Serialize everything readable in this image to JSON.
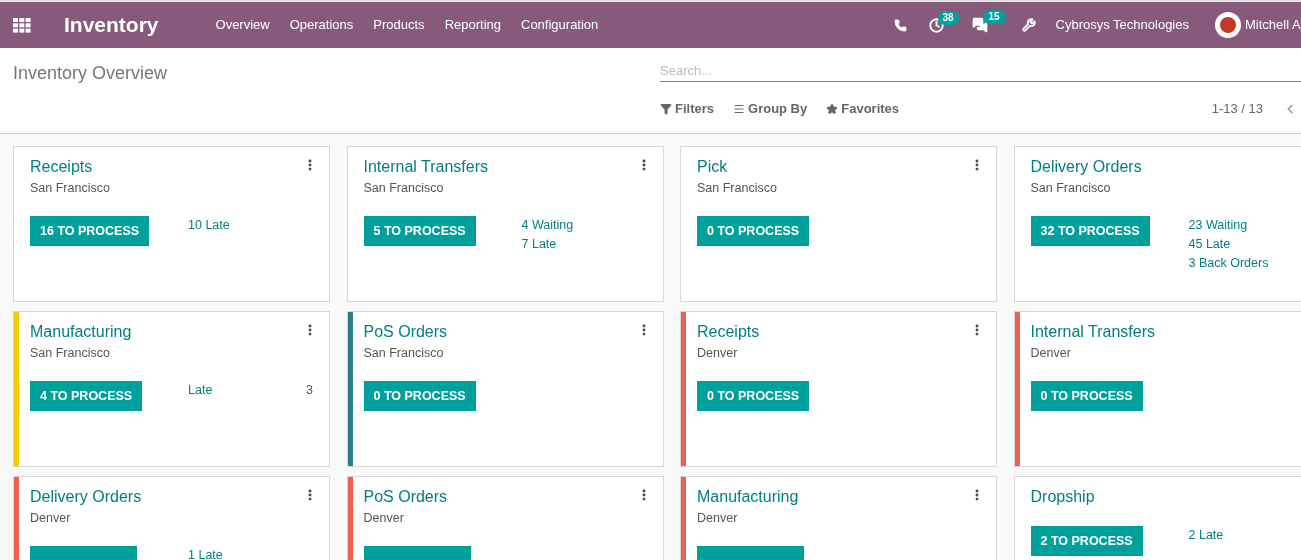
{
  "navbar": {
    "app_title": "Inventory",
    "menu": [
      "Overview",
      "Operations",
      "Products",
      "Reporting",
      "Configuration"
    ],
    "activity_count": "38",
    "message_count": "15",
    "company": "Cybrosys Technologies",
    "user": "Mitchell A"
  },
  "control_panel": {
    "title": "Inventory Overview",
    "search": {
      "placeholder": "Search..."
    },
    "search_options": [
      {
        "kind": "filter",
        "label": "Filters"
      },
      {
        "kind": "group",
        "label": "Group By"
      },
      {
        "kind": "favorite",
        "label": "Favorites"
      }
    ],
    "pager": "1-13 / 13"
  },
  "cards": [
    {
      "title": "Receipts",
      "subtitle": "San Francisco",
      "button": "16 TO PROCESS",
      "stats": [
        {
          "text": "10 Late"
        }
      ]
    },
    {
      "title": "Internal Transfers",
      "subtitle": "San Francisco",
      "button": "5 TO PROCESS",
      "stats": [
        {
          "text": "4 Waiting"
        },
        {
          "text": "7 Late"
        }
      ]
    },
    {
      "title": "Pick",
      "subtitle": "San Francisco",
      "button": "0 TO PROCESS"
    },
    {
      "title": "Delivery Orders",
      "subtitle": "San Francisco",
      "button": "32 TO PROCESS",
      "stats": [
        {
          "text": "23 Waiting"
        },
        {
          "text": "45 Late"
        },
        {
          "text": "3 Back Orders"
        }
      ]
    },
    {
      "title": "Manufacturing",
      "subtitle": "San Francisco",
      "button": "4 TO PROCESS",
      "color": "#f3cc00",
      "stats": [
        {
          "text": "Late",
          "count": "3"
        }
      ]
    },
    {
      "title": "PoS Orders",
      "subtitle": "San Francisco",
      "button": "0 TO PROCESS",
      "color": "#2c7b8f"
    },
    {
      "title": "Receipts",
      "subtitle": "Denver",
      "button": "0 TO PROCESS",
      "color": "#f0604d"
    },
    {
      "title": "Internal Transfers",
      "subtitle": "Denver",
      "button": "0 TO PROCESS",
      "color": "#f0604d"
    },
    {
      "title": "Delivery Orders",
      "subtitle": "Denver",
      "color": "#f0604d",
      "stats": [
        {
          "text": "1 Late"
        }
      ]
    },
    {
      "title": "PoS Orders",
      "subtitle": "Denver",
      "color": "#f0604d"
    },
    {
      "title": "Manufacturing",
      "subtitle": "Denver",
      "color": "#f0604d"
    },
    {
      "title": "Dropship",
      "button": "2 TO PROCESS",
      "stats": [
        {
          "text": "2 Late"
        }
      ]
    }
  ]
}
